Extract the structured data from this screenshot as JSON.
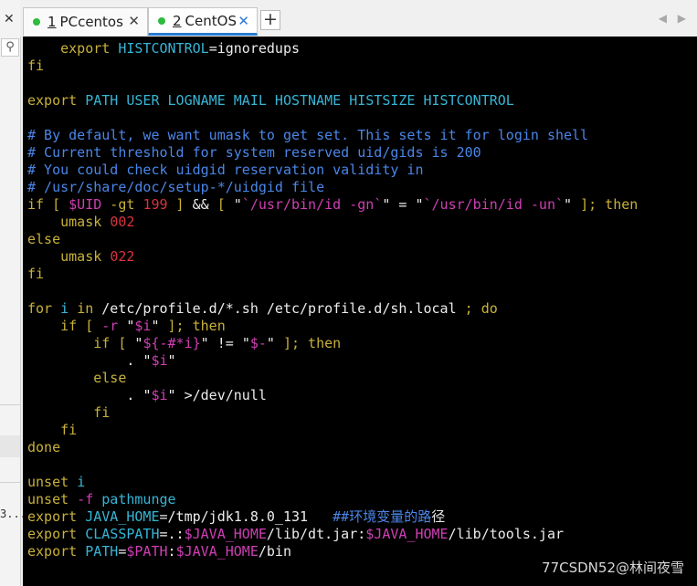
{
  "tabs": [
    {
      "number": "1",
      "label": " PCcentos",
      "close": "✕"
    },
    {
      "number": "2",
      "label": " CentOS",
      "close": "✕"
    }
  ],
  "add_tab": "+",
  "nav_arrows": "◀ ▶",
  "left": {
    "close": "✕",
    "search": "⚲",
    "fragment": "3..."
  },
  "watermark": "77CSDN52@林间夜雪",
  "lines": [
    [
      {
        "t": "    export ",
        "c": "yellow"
      },
      {
        "t": "HISTCONTROL",
        "c": "cyan"
      },
      {
        "t": "=ignoredups",
        "c": "white"
      }
    ],
    [
      {
        "t": "fi",
        "c": "yellow"
      }
    ],
    [],
    [
      {
        "t": "export ",
        "c": "yellow"
      },
      {
        "t": "PATH USER LOGNAME MAIL HOSTNAME HISTSIZE HISTCONTROL",
        "c": "cyan"
      }
    ],
    [],
    [
      {
        "t": "# By default, we want umask to get set. This sets it for login shell",
        "c": "blue"
      }
    ],
    [
      {
        "t": "# Current threshold for system reserved uid/gids is 200",
        "c": "blue"
      }
    ],
    [
      {
        "t": "# You could check uidgid reservation validity in",
        "c": "blue"
      }
    ],
    [
      {
        "t": "# /usr/share/doc/setup-*/uidgid file",
        "c": "blue"
      }
    ],
    [
      {
        "t": "if [ ",
        "c": "yellow"
      },
      {
        "t": "$UID",
        "c": "magenta"
      },
      {
        "t": " -gt ",
        "c": "yellow"
      },
      {
        "t": "199",
        "c": "red"
      },
      {
        "t": " ] ",
        "c": "yellow"
      },
      {
        "t": "&&",
        "c": "white"
      },
      {
        "t": " [ ",
        "c": "yellow"
      },
      {
        "t": "\"",
        "c": "white"
      },
      {
        "t": "`/usr/bin/id -gn`",
        "c": "magenta"
      },
      {
        "t": "\"",
        "c": "white"
      },
      {
        "t": " = ",
        "c": "white"
      },
      {
        "t": "\"",
        "c": "white"
      },
      {
        "t": "`/usr/bin/id -un`",
        "c": "magenta"
      },
      {
        "t": "\"",
        "c": "white"
      },
      {
        "t": " ]; then",
        "c": "yellow"
      }
    ],
    [
      {
        "t": "    umask ",
        "c": "yellow"
      },
      {
        "t": "002",
        "c": "red"
      }
    ],
    [
      {
        "t": "else",
        "c": "yellow"
      }
    ],
    [
      {
        "t": "    umask ",
        "c": "yellow"
      },
      {
        "t": "022",
        "c": "red"
      }
    ],
    [
      {
        "t": "fi",
        "c": "yellow"
      }
    ],
    [],
    [
      {
        "t": "for ",
        "c": "yellow"
      },
      {
        "t": "i ",
        "c": "cyan"
      },
      {
        "t": "in ",
        "c": "yellow"
      },
      {
        "t": "/etc/profile.d/*.sh /etc/profile.d/sh.local",
        "c": "white"
      },
      {
        "t": " ; do",
        "c": "yellow"
      }
    ],
    [
      {
        "t": "    if [ ",
        "c": "yellow"
      },
      {
        "t": "-r ",
        "c": "magenta"
      },
      {
        "t": "\"",
        "c": "white"
      },
      {
        "t": "$i",
        "c": "magenta"
      },
      {
        "t": "\"",
        "c": "white"
      },
      {
        "t": " ]; then",
        "c": "yellow"
      }
    ],
    [
      {
        "t": "        if [ ",
        "c": "yellow"
      },
      {
        "t": "\"",
        "c": "white"
      },
      {
        "t": "${-#*i}",
        "c": "magenta"
      },
      {
        "t": "\"",
        "c": "white"
      },
      {
        "t": " != ",
        "c": "white"
      },
      {
        "t": "\"",
        "c": "white"
      },
      {
        "t": "$-",
        "c": "magenta"
      },
      {
        "t": "\"",
        "c": "white"
      },
      {
        "t": " ]; then",
        "c": "yellow"
      }
    ],
    [
      {
        "t": "            . ",
        "c": "white"
      },
      {
        "t": "\"",
        "c": "white"
      },
      {
        "t": "$i",
        "c": "magenta"
      },
      {
        "t": "\"",
        "c": "white"
      }
    ],
    [
      {
        "t": "        else",
        "c": "yellow"
      }
    ],
    [
      {
        "t": "            . ",
        "c": "white"
      },
      {
        "t": "\"",
        "c": "white"
      },
      {
        "t": "$i",
        "c": "magenta"
      },
      {
        "t": "\"",
        "c": "white"
      },
      {
        "t": " >/dev/null",
        "c": "white"
      }
    ],
    [
      {
        "t": "        fi",
        "c": "yellow"
      }
    ],
    [
      {
        "t": "    fi",
        "c": "yellow"
      }
    ],
    [
      {
        "t": "done",
        "c": "yellow"
      }
    ],
    [],
    [
      {
        "t": "unset ",
        "c": "yellow"
      },
      {
        "t": "i",
        "c": "cyan"
      }
    ],
    [
      {
        "t": "unset ",
        "c": "yellow"
      },
      {
        "t": "-f ",
        "c": "magenta"
      },
      {
        "t": "pathmunge",
        "c": "cyan"
      }
    ],
    [
      {
        "t": "export ",
        "c": "yellow"
      },
      {
        "t": "JAVA_HOME",
        "c": "cyan"
      },
      {
        "t": "=/tmp/jdk1.8.0_131   ",
        "c": "white"
      },
      {
        "t": "##环境变量的路",
        "c": "blue"
      },
      {
        "t": "径",
        "c": "cursor"
      }
    ],
    [
      {
        "t": "export ",
        "c": "yellow"
      },
      {
        "t": "CLASSPATH",
        "c": "cyan"
      },
      {
        "t": "=.:",
        "c": "white"
      },
      {
        "t": "$JAVA_HOME",
        "c": "magenta"
      },
      {
        "t": "/lib/dt.jar:",
        "c": "white"
      },
      {
        "t": "$JAVA_HOME",
        "c": "magenta"
      },
      {
        "t": "/lib/tools.jar",
        "c": "white"
      }
    ],
    [
      {
        "t": "export ",
        "c": "yellow"
      },
      {
        "t": "PATH",
        "c": "cyan"
      },
      {
        "t": "=",
        "c": "white"
      },
      {
        "t": "$PATH",
        "c": "magenta"
      },
      {
        "t": ":",
        "c": "white"
      },
      {
        "t": "$JAVA_HOME",
        "c": "magenta"
      },
      {
        "t": "/bin",
        "c": "white"
      }
    ]
  ]
}
